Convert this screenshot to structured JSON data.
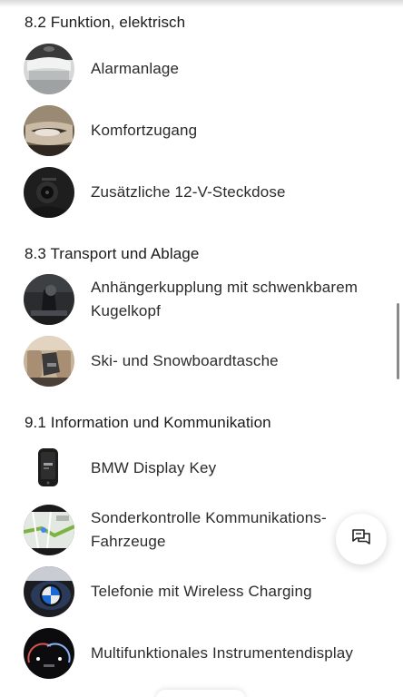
{
  "sections": [
    {
      "title": "8.2 Funktion, elektrisch",
      "items": [
        {
          "label": "Alarmanlage",
          "icon": "alarm-sensor-image"
        },
        {
          "label": "Komfortzugang",
          "icon": "door-handle-image"
        },
        {
          "label": "Zusätzliche 12-V-Steckdose",
          "icon": "power-socket-image"
        }
      ]
    },
    {
      "title": "8.3 Transport und Ablage",
      "items": [
        {
          "label": "Anhängerkupplung mit schwenkbarem Kugelkopf",
          "icon": "tow-hitch-image"
        },
        {
          "label": "Ski- und Snowboardtasche",
          "icon": "ski-bag-image"
        }
      ]
    },
    {
      "title": "9.1 Information und Kommunikation",
      "items": [
        {
          "label": "BMW Display Key",
          "icon": "display-key-image"
        },
        {
          "label": "Sonderkontrolle Kommunikations-Fahrzeuge",
          "icon": "navigation-map-image"
        },
        {
          "label": "Telefonie mit Wireless Charging",
          "icon": "wireless-charging-image"
        },
        {
          "label": "Multifunktionales Instrumentendisplay",
          "icon": "instrument-display-image"
        }
      ]
    }
  ],
  "chat_button": {
    "icon": "chat-icon"
  }
}
